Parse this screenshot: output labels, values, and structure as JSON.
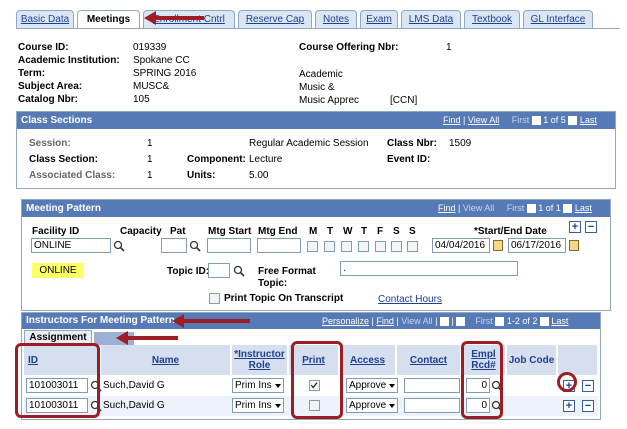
{
  "tabs": [
    {
      "label": "Basic Data"
    },
    {
      "label": "Meetings"
    },
    {
      "label": "Enrollment Cntrl"
    },
    {
      "label": "Reserve Cap"
    },
    {
      "label": "Notes"
    },
    {
      "label": "Exam"
    },
    {
      "label": "LMS Data"
    },
    {
      "label": "Textbook"
    },
    {
      "label": "GL Interface"
    }
  ],
  "course": {
    "course_id_label": "Course ID:",
    "course_id": "019339",
    "institution_label": "Academic Institution:",
    "institution": "Spokane CC",
    "term_label": "Term:",
    "term": "SPRING 2016",
    "term_right": "Academic",
    "subject_label": "Subject Area:",
    "subject": "MUSC&",
    "subject_right": "Music &",
    "catalog_label": "Catalog Nbr:",
    "catalog": "105",
    "catalog_right": "Music Apprec",
    "catalog_tag": "[CCN]",
    "offering_label": "Course Offering Nbr:",
    "offering": "1"
  },
  "class_sections": {
    "title": "Class Sections",
    "find": "Find",
    "view_all": "View All",
    "first": "First",
    "count": "1 of 5",
    "last": "Last",
    "session_label": "Session:",
    "session": "1",
    "session_desc": "Regular Academic Session",
    "class_nbr_label": "Class Nbr:",
    "class_nbr": "1509",
    "section_label": "Class Section:",
    "section": "1",
    "component_label": "Component:",
    "component": "Lecture",
    "event_label": "Event ID:",
    "assoc_label": "Associated Class:",
    "assoc": "1",
    "units_label": "Units:",
    "units": "5.00"
  },
  "meeting_pattern": {
    "title": "Meeting Pattern",
    "find": "Find",
    "view_all": "View All",
    "first": "First",
    "count": "1 of 1",
    "last": "Last",
    "facility_label": "Facility ID",
    "facility": "ONLINE",
    "capacity_label": "Capacity",
    "pat_label": "Pat",
    "mtg_start_label": "Mtg Start",
    "mtg_end_label": "Mtg End",
    "days": [
      "M",
      "T",
      "W",
      "T",
      "F",
      "S",
      "S"
    ],
    "dates_label": "*Start/End Date",
    "start_date": "04/04/2016",
    "end_date": "06/17/2016",
    "facility_desc": "ONLINE",
    "topic_label": "Topic ID:",
    "free_format_label": "Free Format",
    "free_format_label2": "Topic:",
    "free_format_value": ".",
    "print_topic_label": "Print Topic On Transcript",
    "contact_hours": "Contact Hours"
  },
  "instructors": {
    "title": "Instructors For Meeting Pattern",
    "personalize": "Personalize",
    "find": "Find",
    "view_all": "View All",
    "first": "First",
    "count": "1-2 of 2",
    "last": "Last",
    "subtab": "Assignment",
    "columns": {
      "id": "ID",
      "name": "Name",
      "role_1": "*Instructor",
      "role_2": "Role",
      "print": "Print",
      "access": "Access",
      "contact": "Contact",
      "empl_1": "Empl",
      "empl_2": "Rcd#",
      "job_code": "Job Code"
    },
    "rows": [
      {
        "id": "101003011",
        "name": "Such,David G",
        "role": "Prim Ins",
        "print": true,
        "access": "Approve",
        "contact": "",
        "empl_rcd": "0"
      },
      {
        "id": "101003011",
        "name": "Such,David G",
        "role": "Prim Ins",
        "print": false,
        "access": "Approve",
        "contact": "",
        "empl_rcd": "0"
      }
    ]
  },
  "colors": {
    "header_blue": "#557ab5",
    "tab_blue": "#dbe6f4",
    "highlight_yellow": "#ffff66",
    "annotation_red": "#9c1e24"
  }
}
